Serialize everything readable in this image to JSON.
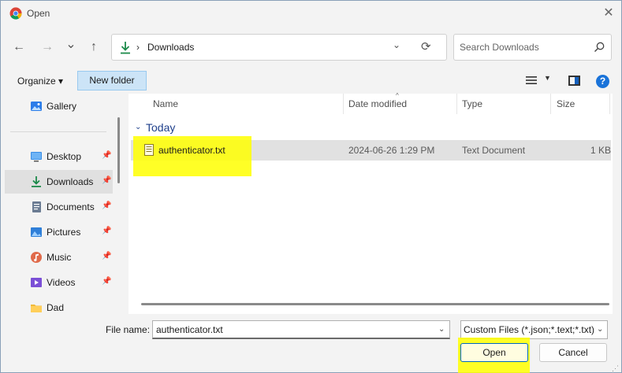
{
  "window": {
    "title": "Open",
    "close_glyph": "✕"
  },
  "nav": {
    "back": "←",
    "forward": "→",
    "recent": "⌄",
    "up": "↑"
  },
  "address": {
    "chevron": "›",
    "location": "Downloads",
    "dropdown": "⌄",
    "refresh": "⟳"
  },
  "search": {
    "placeholder": "Search Downloads"
  },
  "toolbar": {
    "organize_label": "Organize ▾",
    "new_folder_label": "New folder",
    "view_dropdown": "▼",
    "help": "?"
  },
  "sidebar": {
    "items": [
      {
        "label": "Gallery",
        "icon": "gallery-icon",
        "pinned": false
      },
      {
        "label": "Desktop",
        "icon": "desktop-icon",
        "pinned": true
      },
      {
        "label": "Downloads",
        "icon": "download-icon",
        "pinned": true,
        "active": true
      },
      {
        "label": "Documents",
        "icon": "documents-icon",
        "pinned": true
      },
      {
        "label": "Pictures",
        "icon": "pictures-icon",
        "pinned": true
      },
      {
        "label": "Music",
        "icon": "music-icon",
        "pinned": true
      },
      {
        "label": "Videos",
        "icon": "videos-icon",
        "pinned": true
      },
      {
        "label": "Dad",
        "icon": "folder-icon",
        "pinned": false
      }
    ],
    "pin_glyph": "📌"
  },
  "list": {
    "columns": {
      "name": "Name",
      "date": "Date modified",
      "type": "Type",
      "size": "Size"
    },
    "sort_caret": "^",
    "group": {
      "chevron": "⌄",
      "label": "Today"
    },
    "files": [
      {
        "name": "authenticator.txt",
        "date": "2024-06-26 1:29 PM",
        "type": "Text Document",
        "size": "1 KB",
        "highlighted": true
      }
    ]
  },
  "footer": {
    "file_name_label": "File name:",
    "file_name_value": "authenticator.txt",
    "file_name_dropdown": "⌄",
    "filter_value": "Custom Files (*.json;*.text;*.txt)",
    "filter_dropdown": "⌄",
    "open_label": "Open",
    "cancel_label": "Cancel",
    "grip": "⋰"
  },
  "colors": {
    "accent": "#0067c0",
    "highlight": "#ffff00",
    "selected_row": "#e1e1e1",
    "new_folder_bg": "#cce4f7"
  }
}
